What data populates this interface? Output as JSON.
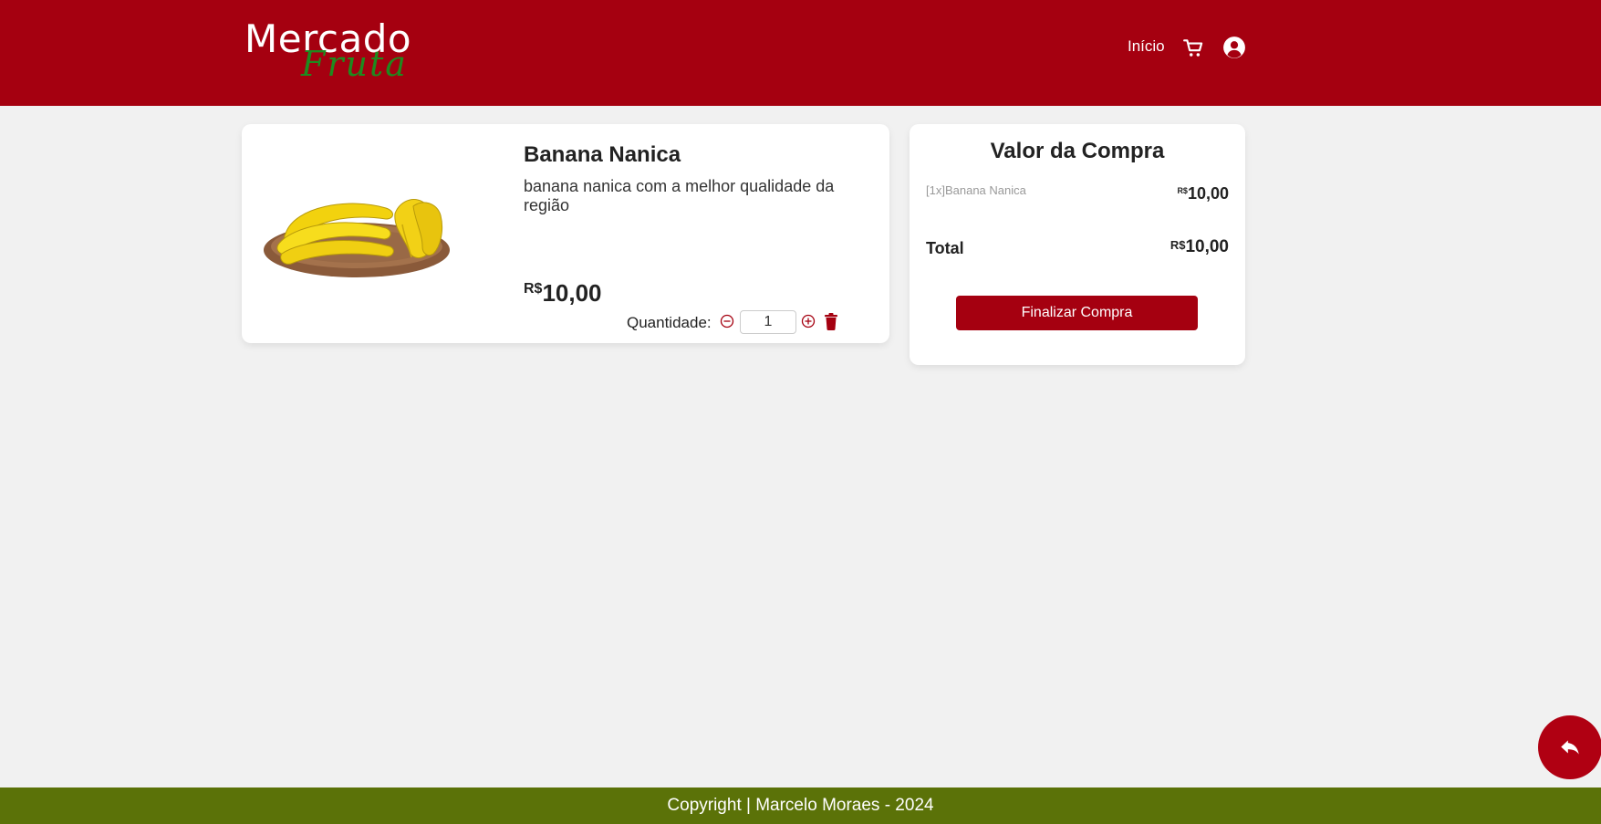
{
  "header": {
    "logo_main": "Mercado",
    "logo_sub": "Fruta",
    "nav_home": "Início",
    "cart_icon": "cart-icon",
    "user_icon": "user-circle-icon"
  },
  "product": {
    "name": "Banana Nanica",
    "description": "banana nanica com a melhor qualidade da região",
    "currency": "R$",
    "price": "10,00",
    "quantity_label": "Quantidade:",
    "quantity": "1",
    "image": "banana-bunch-image"
  },
  "summary": {
    "title": "Valor da Compra",
    "items": [
      {
        "label": "[1x]Banana Nanica",
        "currency": "R$",
        "price": "10,00"
      }
    ],
    "total_label": "Total",
    "total_currency": "R$",
    "total_price": "10,00",
    "checkout_label": "Finalizar Compra"
  },
  "footer": {
    "text": "Copyright | Marcelo Moraes - 2024"
  },
  "colors": {
    "brand_red": "#a50010",
    "footer_green": "#5b7208",
    "logo_green": "#1f8a1f",
    "background": "#f1f1f1"
  }
}
